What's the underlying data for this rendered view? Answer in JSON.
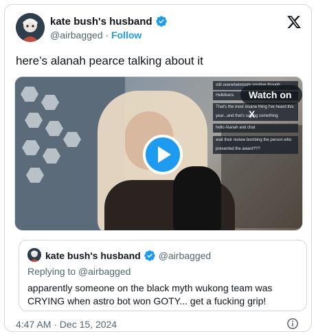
{
  "author": {
    "display_name": "kate bush's husband",
    "handle": "@airbagged",
    "separator": " · ",
    "follow_label": "Follow",
    "verified": true
  },
  "tweet": {
    "text": "here’s alanah pearce talking about it",
    "timestamp": "4:47 AM · Dec 15, 2024"
  },
  "media": {
    "watch_label": "Watch on X",
    "chat_lines": [
      "still overwhelmingly positive though",
      "Helldivers",
      "That's the most insane thing I've heard this",
      "year...and that's saying something",
      "hello Alanah and chat",
      "wait their review bombing the person who",
      "presented the award???"
    ]
  },
  "quote": {
    "display_name": "kate bush's husband",
    "handle": "@airbagged",
    "reply_to": "Replying to @airbagged",
    "text": "apparently someone on the black myth wukong team was CRYING when astro bot won GOTY... get a fucking grip!"
  },
  "icons": {
    "x_logo": "x-logo-icon",
    "verified": "verified-badge-icon",
    "play": "play-icon",
    "info": "info-icon"
  },
  "colors": {
    "accent": "#1d9bf0",
    "text": "#0f1419",
    "secondary": "#536471",
    "border": "#cfd9de"
  }
}
